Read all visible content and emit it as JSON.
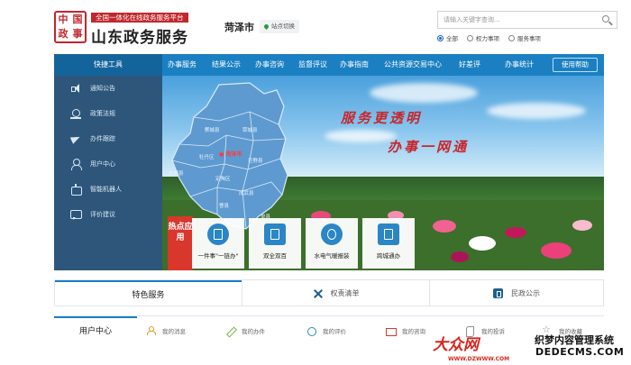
{
  "header": {
    "seal_glyphs": [
      "中",
      "国",
      "政",
      "事"
    ],
    "tagline": "全国一体化在线政务服务平台",
    "site_name": "山东政务服务",
    "city": "菏泽市",
    "switch_label": "站点切换",
    "search_placeholder": "请输入关键字查询...",
    "scopes": [
      {
        "label": "全部",
        "selected": true
      },
      {
        "label": "权力事项",
        "selected": false
      },
      {
        "label": "服务事项",
        "selected": false
      }
    ]
  },
  "nav": {
    "quick_tools": "快捷工具",
    "items": [
      "办事服务",
      "结果公示",
      "办事咨询",
      "监督评议",
      "办事指南",
      "公共资源交易中心",
      "好差评",
      "办事统计"
    ],
    "help": "使用帮助"
  },
  "sidebar": {
    "items": [
      "通知公告",
      "政策法规",
      "办件跟踪",
      "用户中心",
      "智能机器人",
      "评价建议"
    ]
  },
  "banner": {
    "slogan1": "服务更透明",
    "slogan2": "办事一网通",
    "map_city": "菏泽市",
    "map_counties": [
      "鄄城县",
      "郓城县",
      "牡丹区",
      "巨野县",
      "东明县",
      "定陶区",
      "成武县",
      "曹县",
      "单县"
    ],
    "hot_label": "热点应用",
    "apps": [
      {
        "label": "一件事\"一链办\"",
        "icon": "document-icon",
        "color": "#2b86c6"
      },
      {
        "label": "双全双百",
        "icon": "list-icon",
        "color": "#2b86c6"
      },
      {
        "label": "水电气暖报装",
        "icon": "bolt-icon",
        "color": "#2b86c6"
      },
      {
        "label": "跨城通办",
        "icon": "map-doc-icon",
        "color": "#2b86c6"
      }
    ]
  },
  "services": {
    "tabs": [
      "特色服务",
      "权责清单",
      "民政公示"
    ]
  },
  "user_center": {
    "title": "用户中心",
    "links": [
      "我的消息",
      "我的办件",
      "我的评价",
      "我的咨询",
      "我的投诉",
      "我的收藏"
    ]
  },
  "watermark": {
    "logo": "大众网",
    "url": "WWW.DZWWW.COM",
    "cms_line1": "织梦内容管理系统",
    "cms_line2": "DEDECMS.COM"
  },
  "colors": {
    "nav_blue": "#1b80c2",
    "nav_dark": "#14649c",
    "brand_red": "#c1272d",
    "sidebar_bg": "#0a3a64"
  }
}
